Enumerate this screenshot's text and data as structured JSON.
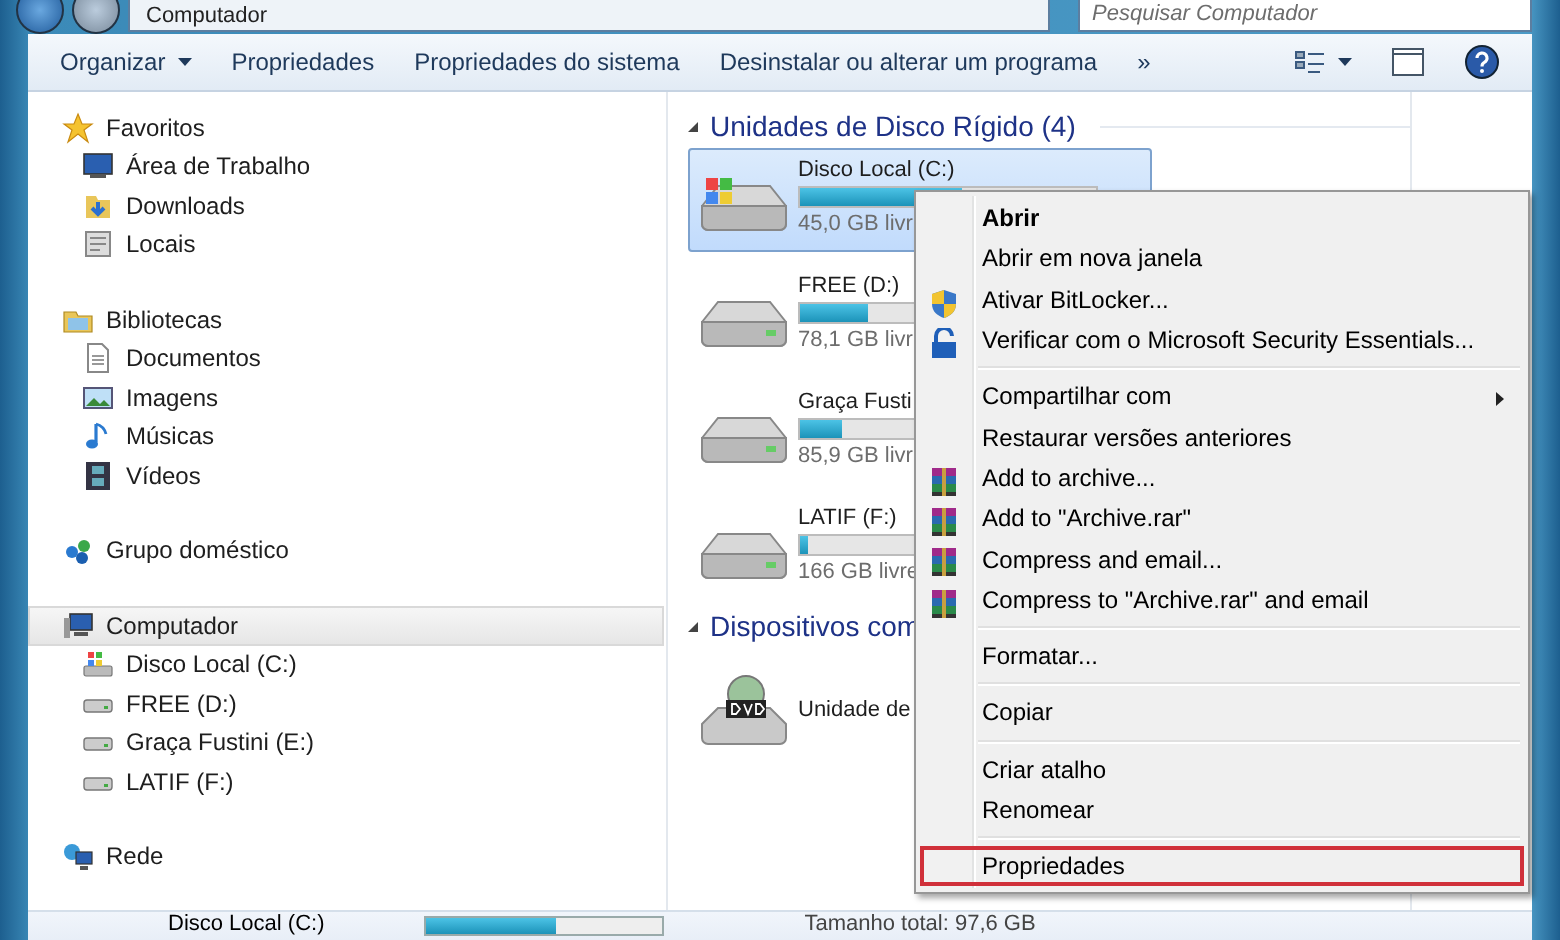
{
  "address": {
    "path": "Computador"
  },
  "search": {
    "placeholder": "Pesquisar Computador"
  },
  "toolbar": {
    "buttons": [
      {
        "label": "Organizar",
        "kind": "dropdown"
      },
      {
        "label": "Propriedades",
        "kind": "button"
      },
      {
        "label": "Propriedades do sistema",
        "kind": "button"
      },
      {
        "label": "Desinstalar ou alterar um programa",
        "kind": "button"
      },
      {
        "label": "»",
        "kind": "button"
      }
    ]
  },
  "sidebar": {
    "groups": [
      {
        "label": "Favoritos",
        "selected": false,
        "children": [
          {
            "label": "Área de Trabalho",
            "selected": false
          },
          {
            "label": "Downloads",
            "selected": false
          },
          {
            "label": "Locais",
            "selected": false
          }
        ]
      },
      {
        "label": "Bibliotecas",
        "selected": false,
        "children": [
          {
            "label": "Documentos",
            "selected": false
          },
          {
            "label": "Imagens",
            "selected": false
          },
          {
            "label": "Músicas",
            "selected": false
          },
          {
            "label": "Vídeos",
            "selected": false
          }
        ]
      },
      {
        "label": "Grupo doméstico",
        "selected": false
      },
      {
        "label": "Computador",
        "selected": true,
        "children": [
          {
            "label": "Disco Local (C:)",
            "selected": false
          },
          {
            "label": "FREE (D:)",
            "selected": false
          },
          {
            "label": "Graça Fustini (E:)",
            "selected": false
          },
          {
            "label": "LATIF (F:)",
            "selected": false
          }
        ]
      },
      {
        "label": "Rede",
        "selected": false
      }
    ]
  },
  "content": {
    "sections": [
      {
        "title": "Unidades de Disco Rígido (4)",
        "items": [
          {
            "kind": "system",
            "name": "Disco Local (C:)",
            "free": "45,0 GB livr",
            "level": 0.55,
            "selected": true
          },
          {
            "kind": "disk",
            "name": "FREE (D:)",
            "free": "78,1 GB livr",
            "level": 0.23,
            "selected": false
          },
          {
            "kind": "disk",
            "name": "Graça Fusti",
            "free": "85,9 GB livr",
            "level": 0.14,
            "selected": false
          },
          {
            "kind": "disk",
            "name": "LATIF (F:)",
            "free": "166 GB livre",
            "level": 0.03,
            "selected": false
          }
        ]
      },
      {
        "title": "Dispositivos com",
        "items": [
          {
            "kind": "dvd",
            "name": "Unidade de",
            "selected": false
          }
        ]
      }
    ]
  },
  "context_menu": {
    "items": [
      {
        "kind": "item",
        "label": "Abrir",
        "default": true,
        "marked": false
      },
      {
        "kind": "item",
        "label": "Abrir em nova janela",
        "default": false,
        "marked": false
      },
      {
        "kind": "item",
        "label": "Ativar BitLocker...",
        "default": false,
        "marked": false
      },
      {
        "kind": "item",
        "label": "Verificar com o Microsoft Security Essentials...",
        "default": false,
        "marked": false
      },
      {
        "kind": "separator"
      },
      {
        "kind": "submenu",
        "label": "Compartilhar com",
        "default": false,
        "marked": false
      },
      {
        "kind": "item",
        "label": "Restaurar versões anteriores",
        "default": false,
        "marked": false
      },
      {
        "kind": "item",
        "label": "Add to archive...",
        "default": false,
        "marked": false
      },
      {
        "kind": "item",
        "label": "Add to \"Archive.rar\"",
        "default": false,
        "marked": false
      },
      {
        "kind": "item",
        "label": "Compress and email...",
        "default": false,
        "marked": false
      },
      {
        "kind": "item",
        "label": "Compress to \"Archive.rar\" and email",
        "default": false,
        "marked": false
      },
      {
        "kind": "separator"
      },
      {
        "kind": "item",
        "label": "Formatar...",
        "default": false,
        "marked": false
      },
      {
        "kind": "separator"
      },
      {
        "kind": "item",
        "label": "Copiar",
        "default": false,
        "marked": false
      },
      {
        "kind": "separator"
      },
      {
        "kind": "item",
        "label": "Criar atalho",
        "default": false,
        "marked": false
      },
      {
        "kind": "item",
        "label": "Renomear",
        "default": false,
        "marked": false
      },
      {
        "kind": "separator"
      },
      {
        "kind": "item",
        "label": "Propriedades",
        "default": false,
        "marked": true
      }
    ]
  },
  "status_bar": {
    "name": "Disco Local (C:)",
    "level": 0.55,
    "total": "Tamanho total: 97,6 GB"
  }
}
